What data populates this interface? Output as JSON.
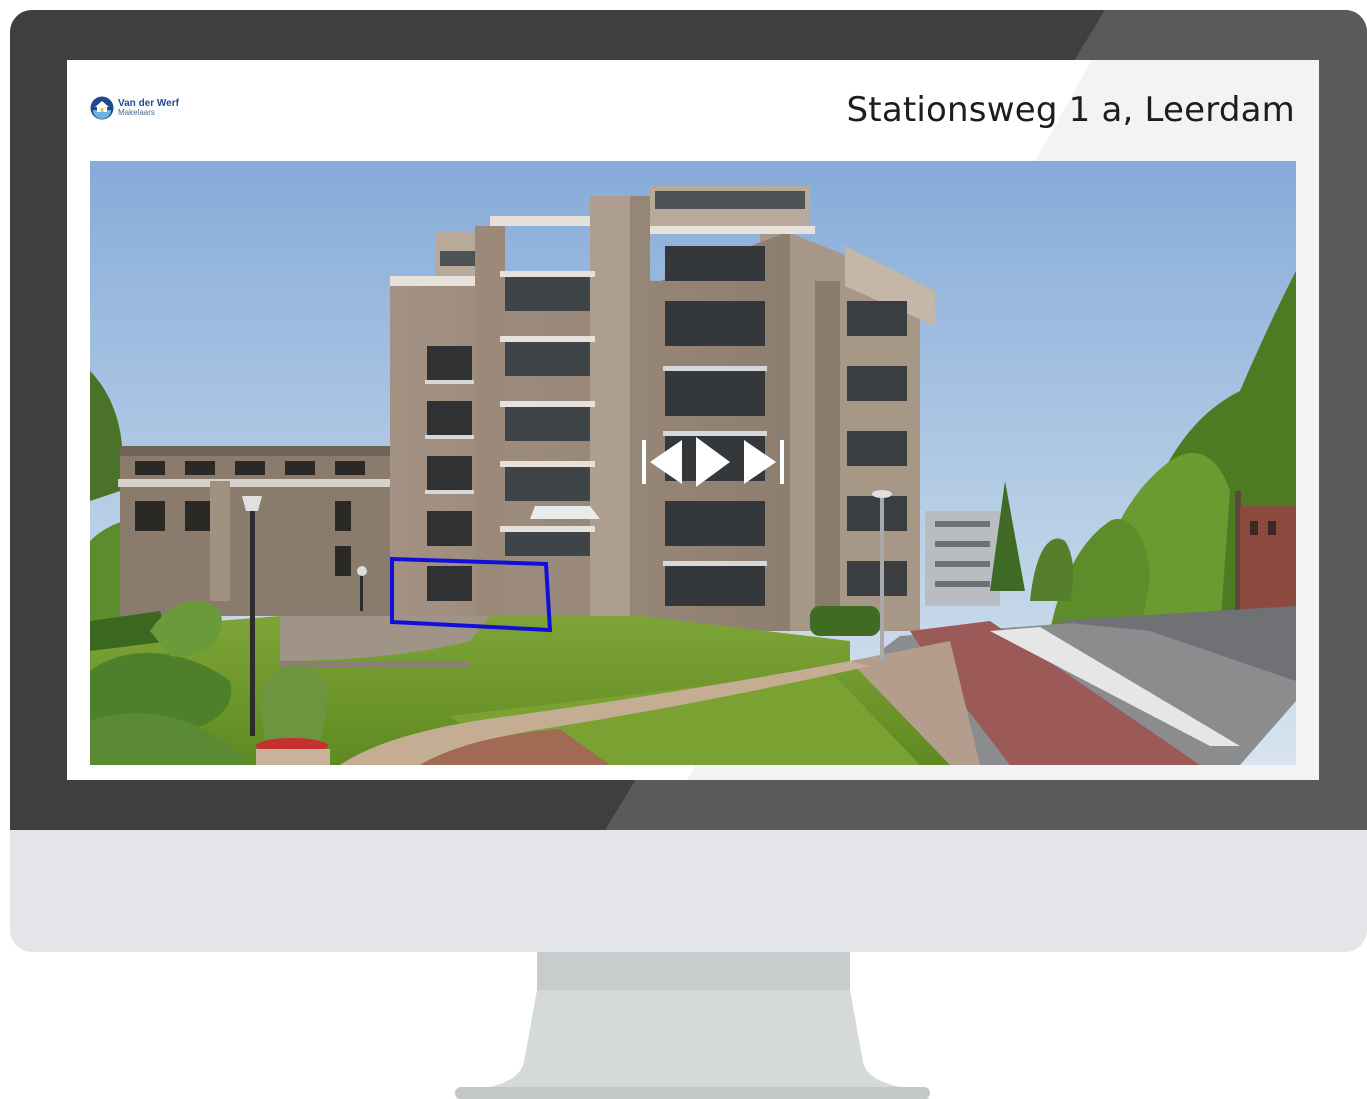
{
  "listing": {
    "address": "Stationsweg 1 a, Leerdam"
  },
  "brand": {
    "name": "Van der Werf",
    "subtitle": "Makelaars",
    "logo_icon": "house-logo-icon",
    "color_primary": "#1f4b8e",
    "color_accent": "#6bb3e0"
  },
  "media": {
    "controls": {
      "previous_icon": "skip-previous-icon",
      "play_icon": "play-icon",
      "next_icon": "skip-next-icon"
    },
    "highlight_color": "#1010d8"
  },
  "device": {
    "bezel_color": "#3f3f3f",
    "chin_color": "#e4e5e9"
  }
}
